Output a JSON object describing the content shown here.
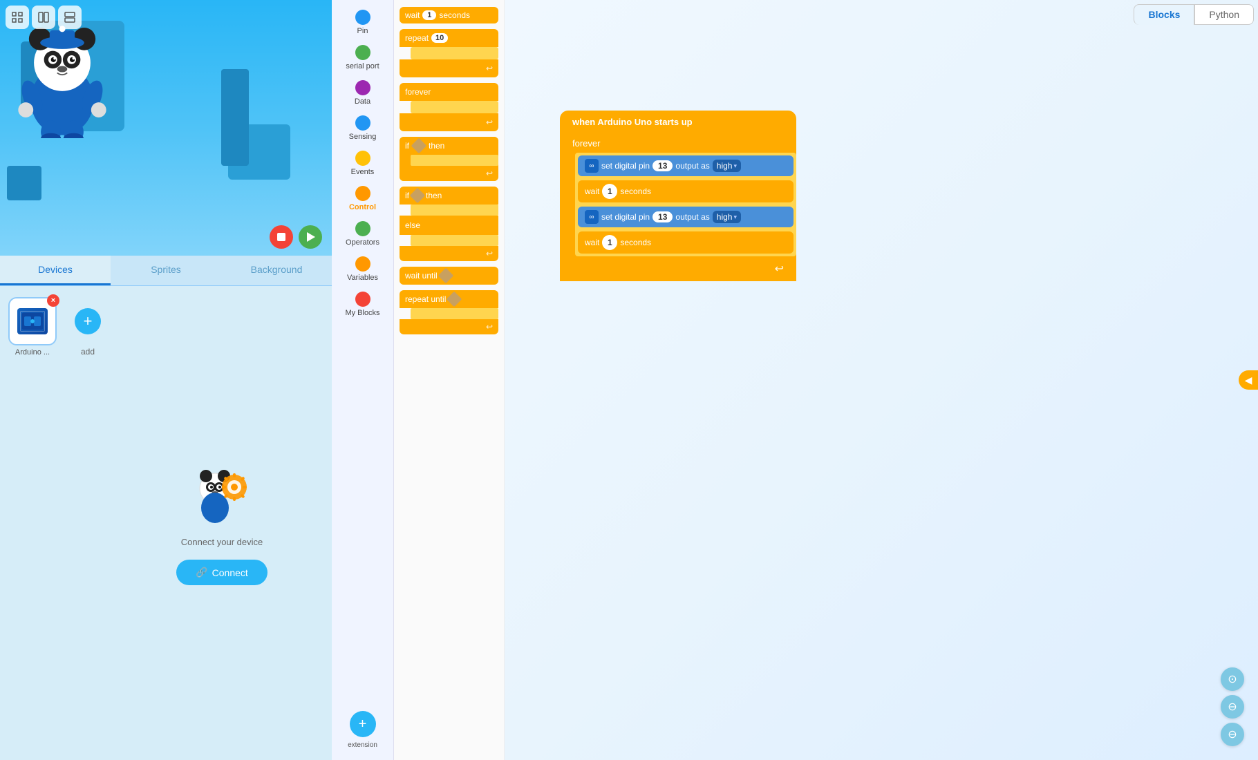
{
  "leftPanel": {
    "tabs": [
      {
        "id": "devices",
        "label": "Devices",
        "active": true
      },
      {
        "id": "sprites",
        "label": "Sprites",
        "active": false
      },
      {
        "id": "background",
        "label": "Background",
        "active": false
      }
    ],
    "device": {
      "name": "Arduino ...",
      "addLabel": "add"
    },
    "connectText": "Connect your device",
    "connectBtn": "Connect"
  },
  "palette": {
    "items": [
      {
        "id": "pin",
        "label": "Pin",
        "color": "#2196F3"
      },
      {
        "id": "serial-port",
        "label": "serial port",
        "color": "#4CAF50"
      },
      {
        "id": "data",
        "label": "Data",
        "color": "#9C27B0"
      },
      {
        "id": "sensing",
        "label": "Sensing",
        "color": "#2196F3"
      },
      {
        "id": "events",
        "label": "Events",
        "color": "#FFC107"
      },
      {
        "id": "control",
        "label": "Control",
        "color": "#FF9800"
      },
      {
        "id": "operators",
        "label": "Operators",
        "color": "#4CAF50"
      },
      {
        "id": "variables",
        "label": "Variables",
        "color": "#FF9800"
      },
      {
        "id": "my-blocks",
        "label": "My Blocks",
        "color": "#f44336"
      }
    ],
    "extension": {
      "label": "extension"
    }
  },
  "blocks": {
    "items": [
      {
        "type": "wait",
        "text": "wait",
        "value": "1",
        "suffix": "seconds"
      },
      {
        "type": "repeat",
        "text": "repeat",
        "value": "10"
      },
      {
        "type": "forever",
        "text": "forever"
      },
      {
        "type": "if-then",
        "text": "if",
        "suffix": "then"
      },
      {
        "type": "if-then-else",
        "text": "if",
        "suffix": "then",
        "else": "else"
      },
      {
        "type": "wait-until",
        "text": "wait until"
      },
      {
        "type": "repeat-until",
        "text": "repeat until"
      }
    ]
  },
  "workspace": {
    "tabs": [
      {
        "id": "blocks",
        "label": "Blocks",
        "active": true
      },
      {
        "id": "python",
        "label": "Python",
        "active": false
      }
    ],
    "codeBlock": {
      "trigger": "when Arduino Uno starts up",
      "forever": "forever",
      "rows": [
        {
          "type": "digital",
          "prefix": "set digital pin",
          "pin": "13",
          "mid": "output as",
          "value": "high"
        },
        {
          "type": "wait",
          "text": "wait",
          "value": "1",
          "suffix": "seconds"
        },
        {
          "type": "digital",
          "prefix": "set digital pin",
          "pin": "13",
          "mid": "output as",
          "value": "high"
        },
        {
          "type": "wait",
          "text": "wait",
          "value": "1",
          "suffix": "seconds"
        }
      ]
    }
  },
  "icons": {
    "expand": "◀",
    "stop": "■",
    "run": "▶",
    "connect": "🔗",
    "close": "×",
    "add": "+",
    "zoomIn": "+",
    "zoomOut": "−",
    "zoomReset": "⊙",
    "infinity": "∞",
    "arrowReturn": "↩",
    "chevronDown": "▾"
  }
}
